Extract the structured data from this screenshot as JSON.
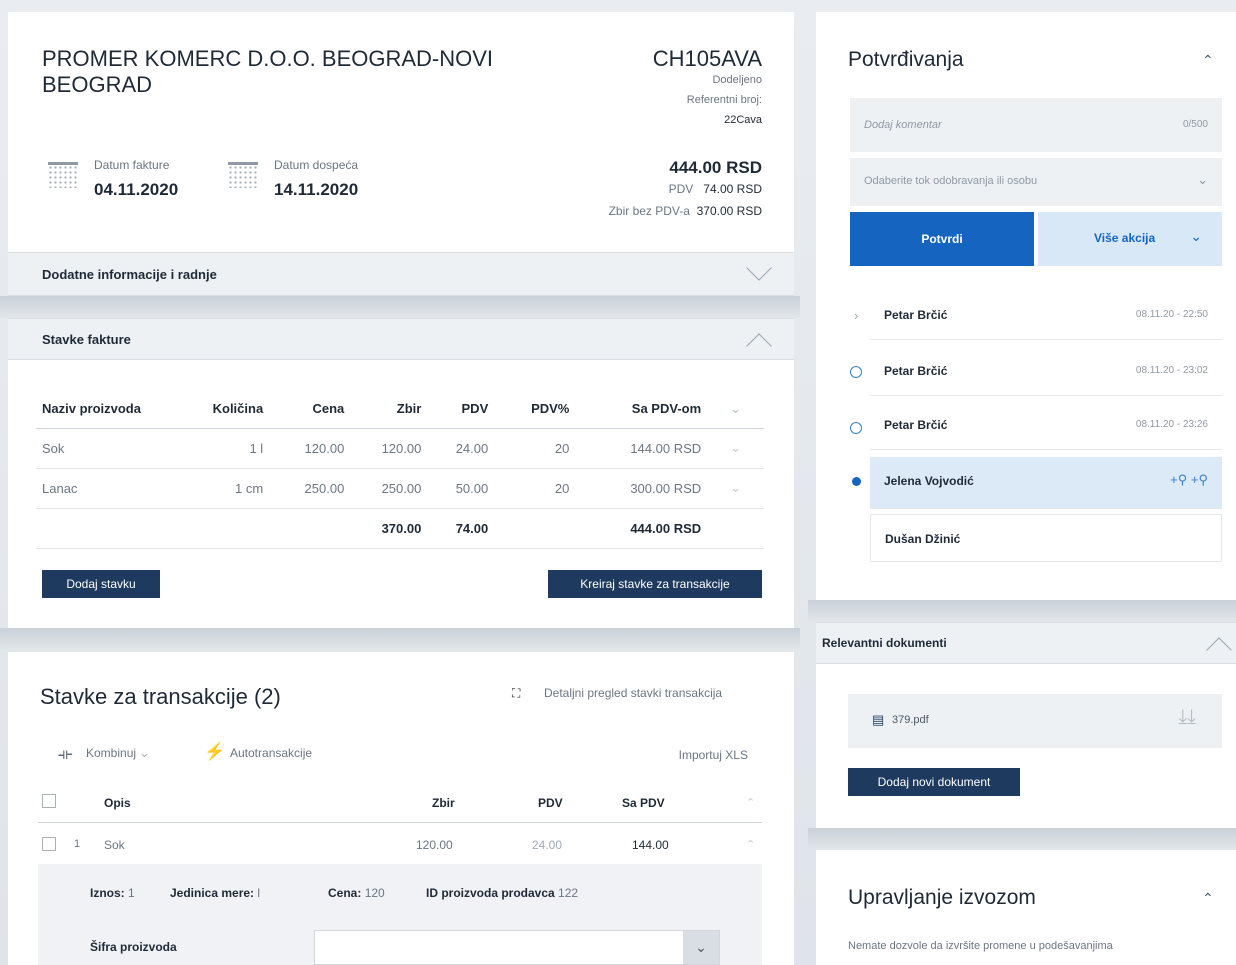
{
  "invoice": {
    "company_name_line1": "PROMER KOMERC D.O.O. BEOGRAD-NOVI",
    "company_name_line2": "BEOGRAD",
    "code": "CH105AVA",
    "status": "Dodeljeno",
    "ref_label": "Referentni broj:",
    "ref_value": "22Cava",
    "invoice_date_label": "Datum fakture",
    "invoice_date": "04.11.2020",
    "due_date_label": "Datum dospeća",
    "due_date": "14.11.2020",
    "total": "444.00 RSD",
    "pdv_label": "PDV",
    "pdv_value": "74.00 RSD",
    "net_label": "Zbir bez PDV-a",
    "net_value": "370.00 RSD"
  },
  "sections": {
    "additional": "Dodatne informacije i radnje",
    "invoice_items": "Stavke fakture"
  },
  "items_table": {
    "headers": [
      "Naziv proizvoda",
      "Količina",
      "Cena",
      "Zbir",
      "PDV",
      "PDV%",
      "Sa PDV-om"
    ],
    "rows": [
      [
        "Sok",
        "1 l",
        "120.00",
        "120.00",
        "24.00",
        "20",
        "144.00 RSD"
      ],
      [
        "Lanac",
        "1 cm",
        "250.00",
        "250.00",
        "50.00",
        "20",
        "300.00 RSD"
      ]
    ],
    "totals": [
      "",
      "",
      "",
      "370.00",
      "74.00",
      "",
      "444.00 RSD"
    ],
    "add_button": "Dodaj stavku",
    "create_button": "Kreiraj stavke za transakcije"
  },
  "transactions": {
    "title": "Stavke za transakcije (2)",
    "detail_link": "Detaljni pregled stavki transakcija",
    "combine": "Kombinuj",
    "auto": "Autotransakcije",
    "import": "Importuj XLS",
    "headers": [
      "Opis",
      "Zbir",
      "PDV",
      "Sa PDV"
    ],
    "row_index": "1",
    "row": [
      "Sok",
      "120.00",
      "24.00",
      "144.00"
    ],
    "detail_amount_label": "Iznos:",
    "detail_amount": "1",
    "detail_unit_label": "Jedinica mere:",
    "detail_unit": "l",
    "detail_price_label": "Cena:",
    "detail_price": "120",
    "detail_seller_label": "ID proizvoda prodavca",
    "detail_seller": "122",
    "product_code_label": "Šifra proizvoda"
  },
  "approvals": {
    "title": "Potvrđivanja",
    "comment_placeholder": "Dodaj komentar",
    "comment_counter": "0/500",
    "flow_placeholder": "Odaberite tok odobravanja ili osobu",
    "confirm": "Potvrdi",
    "more": "Više akcija",
    "history": [
      {
        "name": "Petar Brčić",
        "time": "08.11.20 - 22:50"
      },
      {
        "name": "Petar Brčić",
        "time": "08.11.20 - 23:02"
      },
      {
        "name": "Petar Brčić",
        "time": "08.11.20 - 23:26"
      },
      {
        "name": "Jelena Vojvodić",
        "time": ""
      },
      {
        "name": "Dušan Džinić",
        "time": ""
      }
    ]
  },
  "documents": {
    "title": "Relevantni dokumenti",
    "file": "379.pdf",
    "add": "Dodaj novi dokument"
  },
  "export": {
    "title": "Upravljanje izvozom",
    "note": "Nemate dozvole da izvršite promene u podešavanjima"
  },
  "colors": {
    "primary": "#1565c0",
    "dark_button": "#1e3a5f",
    "light_blue": "#d8e8f7",
    "bullet": "#1565c0"
  }
}
